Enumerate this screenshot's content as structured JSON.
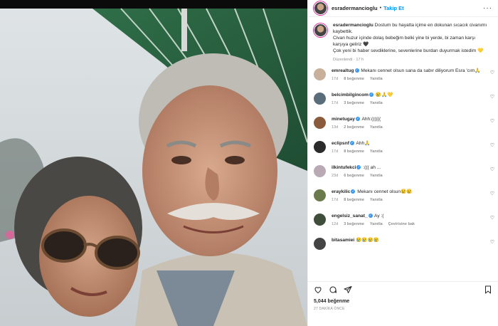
{
  "post": {
    "username": "esradermancioglu",
    "follow_label": "Takip Et",
    "caption": "Dostum bu hayatta içime en dokunan sıcacık civanımı kaybettik.\nCivan huzur içinde dolaş bebeğim belki yine bi yerde, bi zaman karşı karşıya geliriz 🖤\nÇok yeni bi haber sevdiklerine, sevenlerine burdan duyurmak istedim 💛",
    "caption_meta": "Düzenlendi · 17 h",
    "likes": "5,044 beğenme",
    "posted_ago": "27 DAKİKA ÖNCE"
  },
  "comments": [
    {
      "user": "emrealtug",
      "verified": true,
      "text": "Mekanı cennet olsun sana da sabır diliyorum Esra 'cım🙏",
      "age": "17d",
      "likes": "8 beğenme",
      "reply": "Yanıtla",
      "avatar_color": "#c8b09a"
    },
    {
      "user": "belcimbilgincom",
      "verified": true,
      "text": "😢🙏💛",
      "age": "17d",
      "likes": "3 beğenme",
      "reply": "Yanıtla",
      "avatar_color": "#5a6d7a"
    },
    {
      "user": "minetugay",
      "verified": true,
      "text": "Ahh:((((((",
      "age": "13d",
      "likes": "2 beğenme",
      "reply": "Yanıtla",
      "avatar_color": "#8a5a3a"
    },
    {
      "user": "eclipsnf",
      "verified": true,
      "text": "Ahh🙏",
      "age": "17d",
      "likes": "8 beğenme",
      "reply": "Yanıtla",
      "avatar_color": "#2b2b2b"
    },
    {
      "user": "ilkintufekci",
      "verified": true,
      "text": ":((( ah ...",
      "age": "23d",
      "likes": "6 beğenme",
      "reply": "Yanıtla",
      "avatar_color": "#b9a9b4"
    },
    {
      "user": "eraykilic",
      "verified": true,
      "text": "Mekanı cennet olsun😢😢",
      "age": "17d",
      "likes": "8 beğenme",
      "reply": "Yanıtla",
      "avatar_color": "#6b7a4a"
    },
    {
      "user": "engelsiz_sanat_",
      "verified": true,
      "text": "Ay :(",
      "age": "12d",
      "likes": "3 beğenme",
      "reply": "Yanıtla",
      "translate": "Çevirisine bak",
      "avatar_color": "#3e4e3a"
    },
    {
      "user": "bitasamiei",
      "verified": false,
      "text": "😢😢😢😢",
      "age": "",
      "likes": "",
      "reply": "",
      "avatar_color": "#444"
    }
  ],
  "icons": [
    "heart-icon",
    "comment-icon",
    "share-icon",
    "bookmark-icon",
    "more-icon"
  ]
}
